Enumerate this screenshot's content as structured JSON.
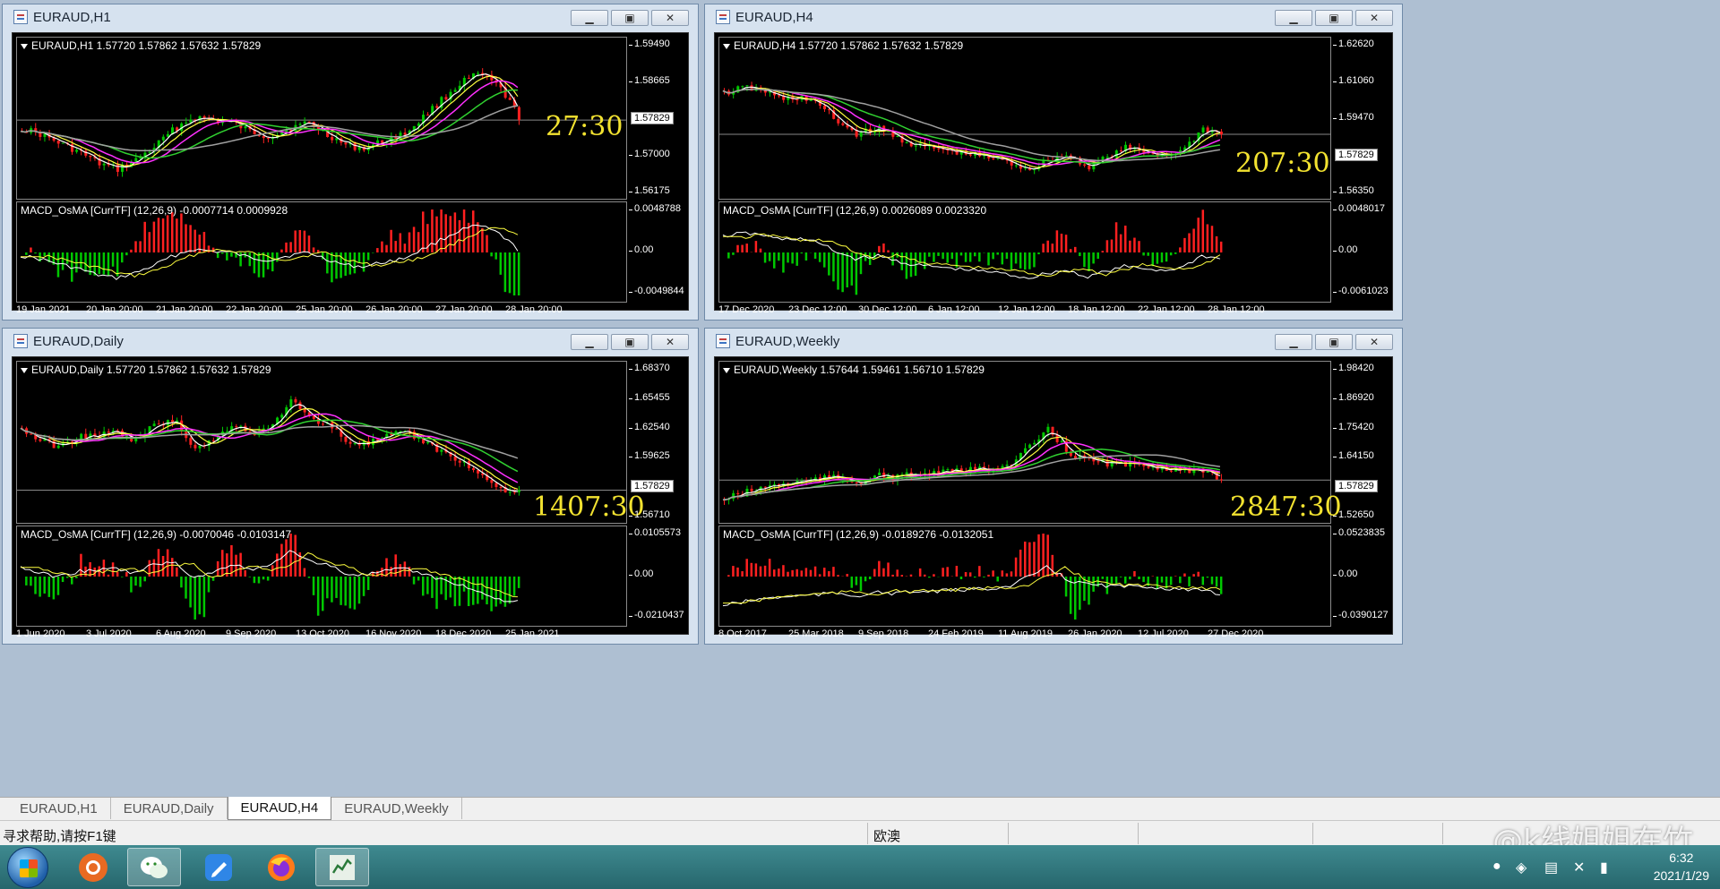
{
  "colors": {
    "bull": "#00c800",
    "bear": "#ff2020",
    "ma_fast": "#ffffff",
    "ma_yellow": "#ffff40",
    "ma_magenta": "#ff30ff",
    "ma_green": "#30d030",
    "ma_gray": "#a0a0a0",
    "timer": "#f2e230"
  },
  "windows": [
    {
      "title": "EURAUD,H1",
      "header": "EURAUD,H1  1.57720 1.57862 1.57632 1.57829",
      "macd_label": "MACD_OsMA [CurrTF] (12,26,9) -0.0007714 0.0009928",
      "price_ticks": [
        "1.59490",
        "1.58665",
        "1.57829",
        "1.57000",
        "1.56175"
      ],
      "macd_ticks": [
        "0.0048788",
        "0.00",
        "-0.0049844"
      ],
      "current_price": "1.57829",
      "timer": "27:30",
      "x_ticks": [
        "19 Jan 2021",
        "20 Jan 20:00",
        "21 Jan 20:00",
        "22 Jan 20:00",
        "25 Jan 20:00",
        "26 Jan 20:00",
        "27 Jan 20:00",
        "28 Jan 20:00"
      ]
    },
    {
      "title": "EURAUD,H4",
      "header": "EURAUD,H4  1.57720 1.57862 1.57632 1.57829",
      "macd_label": "MACD_OsMA [CurrTF] (12,26,9) 0.0026089 0.0023320",
      "price_ticks": [
        "1.62620",
        "1.61060",
        "1.59470",
        "1.57829",
        "1.56350"
      ],
      "macd_ticks": [
        "0.0048017",
        "0.00",
        "-0.0061023"
      ],
      "current_price": "1.57829",
      "timer": "207:30",
      "x_ticks": [
        "17 Dec 2020",
        "23 Dec 12:00",
        "30 Dec 12:00",
        "6 Jan 12:00",
        "12 Jan 12:00",
        "18 Jan 12:00",
        "22 Jan 12:00",
        "28 Jan 12:00"
      ]
    },
    {
      "title": "EURAUD,Daily",
      "header": "EURAUD,Daily  1.57720 1.57862 1.57632 1.57829",
      "macd_label": "MACD_OsMA [CurrTF] (12,26,9) -0.0070046 -0.0103147",
      "price_ticks": [
        "1.68370",
        "1.65455",
        "1.62540",
        "1.59625",
        "1.57829",
        "1.56710"
      ],
      "macd_ticks": [
        "0.0105573",
        "0.00",
        "-0.0210437"
      ],
      "current_price": "1.57829",
      "timer": "1407:30",
      "x_ticks": [
        "1 Jun 2020",
        "3 Jul 2020",
        "6 Aug 2020",
        "9 Sep 2020",
        "13 Oct 2020",
        "16 Nov 2020",
        "18 Dec 2020",
        "25 Jan 2021"
      ]
    },
    {
      "title": "EURAUD,Weekly",
      "header": "EURAUD,Weekly  1.57644 1.59461 1.56710 1.57829",
      "macd_label": "MACD_OsMA [CurrTF] (12,26,9) -0.0189276 -0.0132051",
      "price_ticks": [
        "1.98420",
        "1.86920",
        "1.75420",
        "1.64150",
        "1.57829",
        "1.52650"
      ],
      "macd_ticks": [
        "0.0523835",
        "0.00",
        "-0.0390127"
      ],
      "current_price": "1.57829",
      "timer": "2847:30",
      "x_ticks": [
        "8 Oct 2017",
        "25 Mar 2018",
        "9 Sep 2018",
        "24 Feb 2019",
        "11 Aug 2019",
        "26 Jan 2020",
        "12 Jul 2020",
        "27 Dec 2020"
      ]
    }
  ],
  "tabs": [
    "EURAUD,H1",
    "EURAUD,Daily",
    "EURAUD,H4",
    "EURAUD,Weekly"
  ],
  "active_tab": "EURAUD,H4",
  "status": {
    "help": "寻求帮助,请按F1键",
    "profile": "欧澳"
  },
  "clock": {
    "time": "6:32",
    "date": "2021/1/29"
  },
  "watermark": "@k线姐姐在竹",
  "window_buttons": {
    "minimize": "▁",
    "restore": "▣",
    "close": "✕"
  }
}
